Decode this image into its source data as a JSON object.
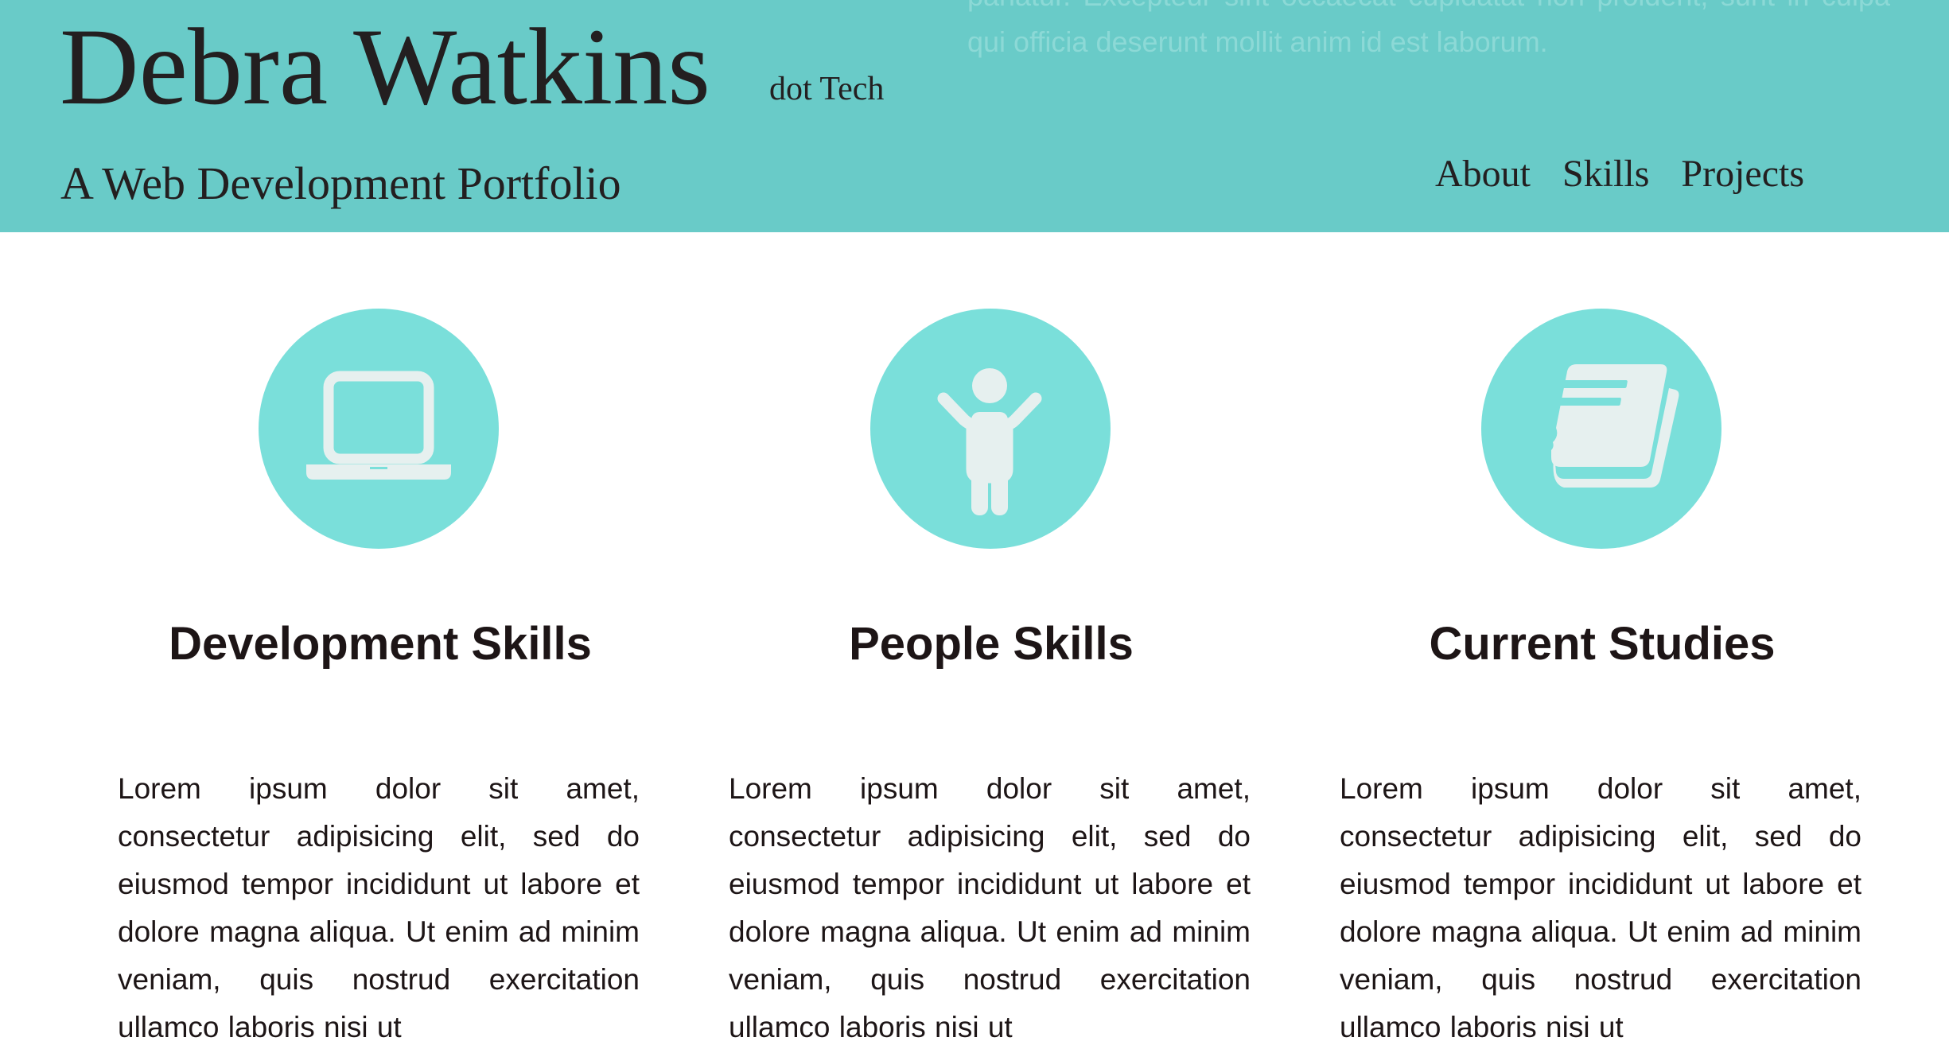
{
  "header": {
    "background_overflow_text": "pariatur. Excepteur sint occaecat cupidatat non proident, sunt in culpa qui officia deserunt mollit anim id est laborum.",
    "title": "Debra Watkins",
    "subtitle": "dot Tech",
    "tagline": "A Web Development Portfolio",
    "nav": [
      {
        "label": "About"
      },
      {
        "label": "Skills"
      },
      {
        "label": "Projects"
      }
    ]
  },
  "features": [
    {
      "icon": "laptop-icon",
      "title": "Development Skills",
      "text": "Lorem ipsum dolor sit amet, consectetur adipisicing elit, sed do eiusmod tempor incididunt ut labore et dolore magna aliqua. Ut enim ad minim veniam, quis nostrud exercitation ullamco laboris nisi ut"
    },
    {
      "icon": "person-icon",
      "title": "People Skills",
      "text": "Lorem ipsum dolor sit amet, consectetur adipisicing elit, sed do eiusmod tempor incididunt ut labore et dolore magna aliqua. Ut enim ad minim veniam, quis nostrud exercitation ullamco laboris nisi ut"
    },
    {
      "icon": "book-icon",
      "title": "Current Studies",
      "text": "Lorem ipsum dolor sit amet, consectetur adipisicing elit, sed do eiusmod tempor incididunt ut labore et dolore magna aliqua. Ut enim ad minim veniam, quis nostrud exercitation ullamco laboris nisi ut"
    }
  ],
  "colors": {
    "header_bg": "#69cbc8",
    "icon_circle": "#7adfda",
    "icon_fill": "#e6f0ef",
    "text": "#1d1516"
  }
}
